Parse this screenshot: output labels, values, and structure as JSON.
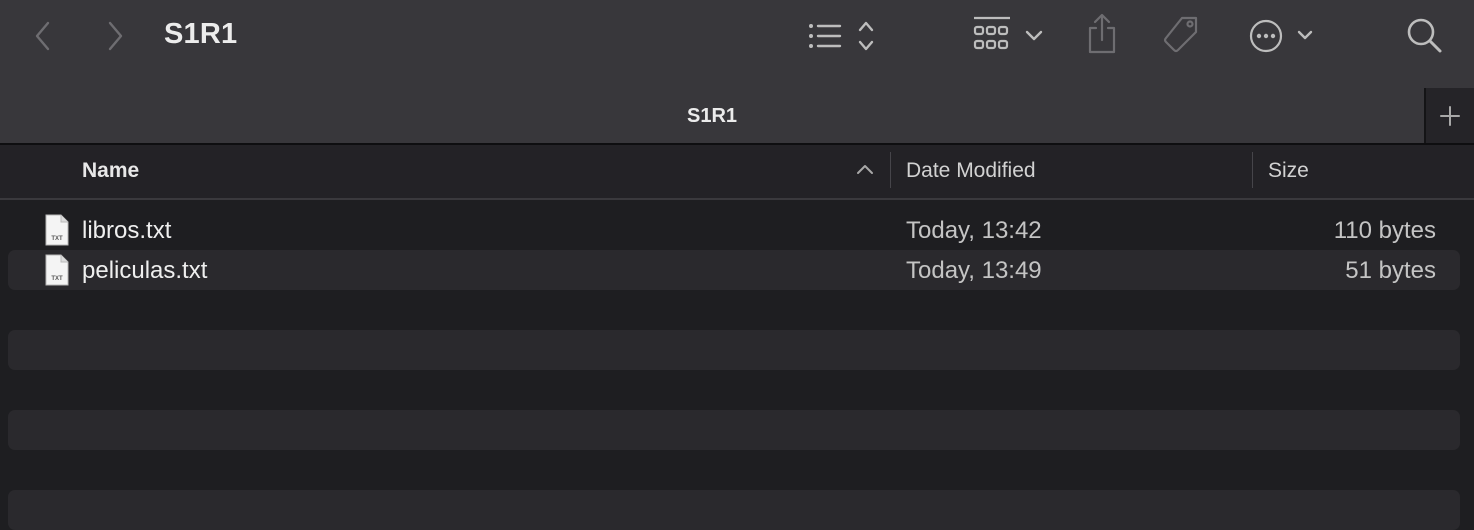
{
  "window": {
    "title": "S1R1"
  },
  "toolbar": {
    "back_icon": "chevron-left-icon",
    "forward_icon": "chevron-right-icon",
    "view_list_icon": "list-view-icon",
    "group_icon": "grid-group-icon",
    "share_icon": "share-icon",
    "tag_icon": "tag-icon",
    "more_icon": "ellipsis-circle-icon",
    "search_icon": "search-icon"
  },
  "tabs": [
    {
      "label": "S1R1",
      "active": true
    }
  ],
  "columns": {
    "name": "Name",
    "date_modified": "Date Modified",
    "size": "Size",
    "sort": "name-ascending"
  },
  "files": [
    {
      "name": "libros.txt",
      "date_modified": "Today, 13:42",
      "size": "110 bytes",
      "icon": "txt",
      "icon_name": "txt-file-icon"
    },
    {
      "name": "peliculas.txt",
      "date_modified": "Today, 13:49",
      "size": "51 bytes",
      "icon": "txt",
      "icon_name": "txt-file-icon"
    }
  ],
  "colors": {
    "toolbar_bg": "#38373b",
    "list_bg": "#1e1e21",
    "row_alt_bg": "#2a292d",
    "text_primary": "#efefef",
    "text_secondary": "#c4c4c4"
  }
}
